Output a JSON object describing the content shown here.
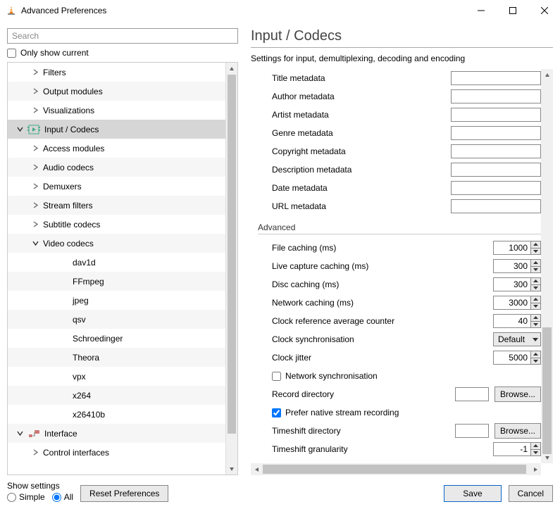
{
  "window": {
    "title": "Advanced Preferences"
  },
  "left": {
    "search_placeholder": "Search",
    "only_show_current": "Only show current",
    "tree": [
      {
        "label": "Filters",
        "indent": 1,
        "chev": "right",
        "icon": false,
        "sel": false
      },
      {
        "label": "Output modules",
        "indent": 1,
        "chev": "right",
        "icon": false,
        "sel": false
      },
      {
        "label": "Visualizations",
        "indent": 1,
        "chev": "right",
        "icon": false,
        "sel": false
      },
      {
        "label": "Input / Codecs",
        "indent": 0,
        "chev": "down",
        "icon": "codec",
        "sel": true
      },
      {
        "label": "Access modules",
        "indent": 1,
        "chev": "right",
        "icon": false,
        "sel": false
      },
      {
        "label": "Audio codecs",
        "indent": 1,
        "chev": "right",
        "icon": false,
        "sel": false
      },
      {
        "label": "Demuxers",
        "indent": 1,
        "chev": "right",
        "icon": false,
        "sel": false
      },
      {
        "label": "Stream filters",
        "indent": 1,
        "chev": "right",
        "icon": false,
        "sel": false
      },
      {
        "label": "Subtitle codecs",
        "indent": 1,
        "chev": "right",
        "icon": false,
        "sel": false
      },
      {
        "label": "Video codecs",
        "indent": 1,
        "chev": "down",
        "icon": false,
        "sel": false
      },
      {
        "label": "dav1d",
        "indent": 2,
        "chev": "",
        "icon": false,
        "sel": false
      },
      {
        "label": "FFmpeg",
        "indent": 2,
        "chev": "",
        "icon": false,
        "sel": false
      },
      {
        "label": "jpeg",
        "indent": 2,
        "chev": "",
        "icon": false,
        "sel": false
      },
      {
        "label": "qsv",
        "indent": 2,
        "chev": "",
        "icon": false,
        "sel": false
      },
      {
        "label": "Schroedinger",
        "indent": 2,
        "chev": "",
        "icon": false,
        "sel": false
      },
      {
        "label": "Theora",
        "indent": 2,
        "chev": "",
        "icon": false,
        "sel": false
      },
      {
        "label": "vpx",
        "indent": 2,
        "chev": "",
        "icon": false,
        "sel": false
      },
      {
        "label": "x264",
        "indent": 2,
        "chev": "",
        "icon": false,
        "sel": false
      },
      {
        "label": "x26410b",
        "indent": 2,
        "chev": "",
        "icon": false,
        "sel": false
      },
      {
        "label": "Interface",
        "indent": 0,
        "chev": "down",
        "icon": "interface",
        "sel": false
      },
      {
        "label": "Control interfaces",
        "indent": 1,
        "chev": "right",
        "icon": false,
        "sel": false
      }
    ]
  },
  "page": {
    "title": "Input / Codecs",
    "subtitle": "Settings for input, demultiplexing, decoding and encoding",
    "meta": [
      "Title metadata",
      "Author metadata",
      "Artist metadata",
      "Genre metadata",
      "Copyright metadata",
      "Description metadata",
      "Date metadata",
      "URL metadata"
    ],
    "advanced_heading": "Advanced",
    "spins": [
      {
        "label": "File caching (ms)",
        "value": "1000"
      },
      {
        "label": "Live capture caching (ms)",
        "value": "300"
      },
      {
        "label": "Disc caching (ms)",
        "value": "300"
      },
      {
        "label": "Network caching (ms)",
        "value": "3000"
      },
      {
        "label": "Clock reference average counter",
        "value": "40"
      }
    ],
    "clock_sync_label": "Clock synchronisation",
    "clock_sync_value": "Default",
    "clock_jitter": {
      "label": "Clock jitter",
      "value": "5000"
    },
    "net_sync": "Network synchronisation",
    "record_dir_label": "Record directory",
    "browse": "Browse...",
    "prefer_native": "Prefer native stream recording",
    "timeshift_dir_label": "Timeshift directory",
    "timeshift_gran": {
      "label": "Timeshift granularity",
      "value": "-1"
    }
  },
  "footer": {
    "show_settings": "Show settings",
    "simple": "Simple",
    "all": "All",
    "reset": "Reset Preferences",
    "save": "Save",
    "cancel": "Cancel"
  }
}
